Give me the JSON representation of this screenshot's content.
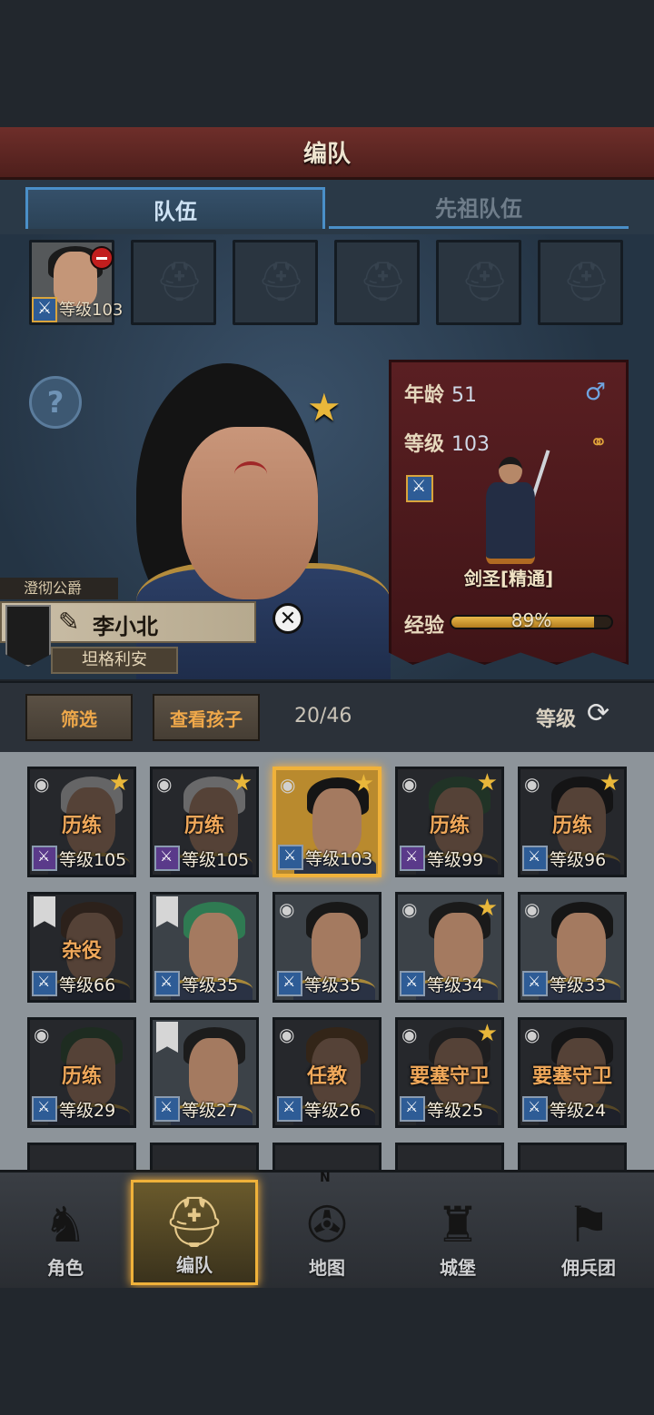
{
  "header": {
    "title": "编队"
  },
  "tabs": [
    {
      "label": "队伍",
      "active": true
    },
    {
      "label": "先祖队伍",
      "active": false
    }
  ],
  "team_slots": {
    "first": {
      "level_text": "等级103"
    },
    "empty_count": 5
  },
  "character": {
    "noble_title": "澄彻公爵",
    "name": "李小北",
    "region": "坦格利安",
    "favorite": true,
    "stats": {
      "age_label": "年龄",
      "age": "51",
      "level_label": "等级",
      "level": "103",
      "class_name": "剑圣[精通]",
      "exp_label": "经验",
      "exp_percent": 0.89,
      "exp_text": "89%"
    }
  },
  "toolbar": {
    "filter": "筛选",
    "view_children": "查看孩子",
    "count": "20/46",
    "sort_label": "等级"
  },
  "roster": [
    {
      "status": "历练",
      "level": "等级105",
      "star": true,
      "class": "staff",
      "hair": "#c8c8c8",
      "dim": true
    },
    {
      "status": "历练",
      "level": "等级105",
      "star": true,
      "class": "staff",
      "hair": "#d0d0d0",
      "dim": true
    },
    {
      "status": "",
      "level": "等级103",
      "star": true,
      "class": "sword",
      "hair": "#151515",
      "dim": false,
      "selected": true
    },
    {
      "status": "历练",
      "level": "等级99",
      "star": true,
      "class": "staff",
      "hair": "#2f5a3a",
      "dim": true
    },
    {
      "status": "历练",
      "level": "等级96",
      "star": true,
      "class": "sword",
      "hair": "#141414",
      "dim": true
    },
    {
      "status": "杂役",
      "level": "等级66",
      "star": false,
      "class": "sword",
      "hair": "#4a3222",
      "dim": true,
      "banner": true
    },
    {
      "status": "",
      "level": "等级35",
      "star": false,
      "class": "sword",
      "hair": "#2f7a52",
      "dim": false,
      "banner": true
    },
    {
      "status": "",
      "level": "等级35",
      "star": false,
      "class": "sword",
      "hair": "#181818",
      "dim": false
    },
    {
      "status": "",
      "level": "等级34",
      "star": true,
      "class": "sword",
      "hair": "#1a1a1a",
      "dim": false
    },
    {
      "status": "",
      "level": "等级33",
      "star": false,
      "class": "sword",
      "hair": "#161616",
      "dim": false
    },
    {
      "status": "历练",
      "level": "等级29",
      "star": false,
      "class": "sword",
      "hair": "#2a4a30",
      "dim": true
    },
    {
      "status": "",
      "level": "等级27",
      "star": false,
      "class": "sword",
      "hair": "#1c1c1c",
      "dim": false,
      "banner": true
    },
    {
      "status": "任教",
      "level": "等级26",
      "star": false,
      "class": "sword",
      "hair": "#5a3a1c",
      "dim": true
    },
    {
      "status": "要塞守卫",
      "level": "等级25",
      "star": true,
      "class": "sword",
      "hair": "#2a2a2a",
      "dim": true
    },
    {
      "status": "要塞守卫",
      "level": "等级24",
      "star": false,
      "class": "sword",
      "hair": "#1a1a1a",
      "dim": true
    }
  ],
  "nav": [
    {
      "label": "角色",
      "icon": "knight-icon",
      "active": false
    },
    {
      "label": "编队",
      "icon": "helmet-icon",
      "active": true
    },
    {
      "label": "地图",
      "icon": "compass-map-icon",
      "active": false
    },
    {
      "label": "城堡",
      "icon": "castle-icon",
      "active": false
    },
    {
      "label": "佣兵团",
      "icon": "mercenary-flag-icon",
      "active": false
    }
  ],
  "nav_compass_letter": "N"
}
